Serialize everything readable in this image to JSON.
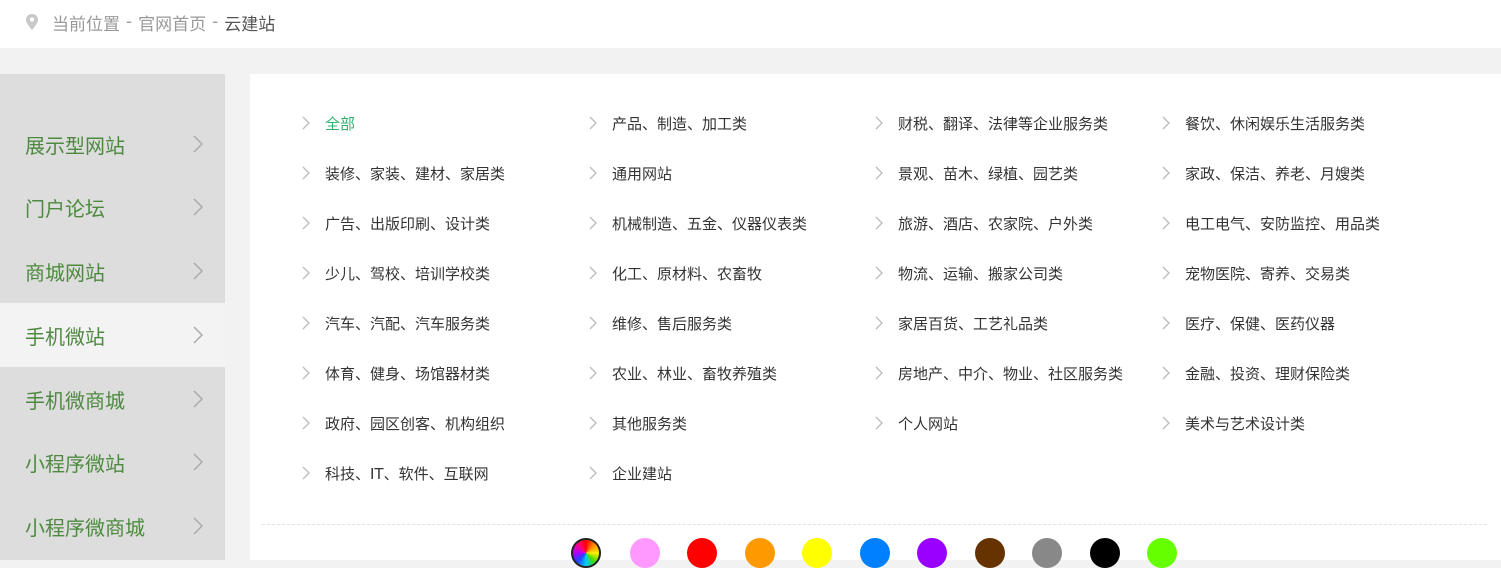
{
  "breadcrumb": {
    "label": "当前位置",
    "sep1": "-",
    "home": "官网首页",
    "sep2": "-",
    "current": "云建站"
  },
  "sidebar": {
    "items": [
      {
        "label": "展示型网站"
      },
      {
        "label": "门户论坛"
      },
      {
        "label": "商城网站"
      },
      {
        "label": "手机微站",
        "active": true
      },
      {
        "label": "手机微商城"
      },
      {
        "label": "小程序微站"
      },
      {
        "label": "小程序微商城"
      }
    ]
  },
  "categories": {
    "items": [
      {
        "label": "全部",
        "active": true
      },
      {
        "label": "产品、制造、加工类"
      },
      {
        "label": "财税、翻译、法律等企业服务类"
      },
      {
        "label": "餐饮、休闲娱乐生活服务类"
      },
      {
        "label": "装修、家装、建材、家居类"
      },
      {
        "label": "通用网站"
      },
      {
        "label": "景观、苗木、绿植、园艺类"
      },
      {
        "label": "家政、保洁、养老、月嫂类"
      },
      {
        "label": "广告、出版印刷、设计类"
      },
      {
        "label": "机械制造、五金、仪器仪表类"
      },
      {
        "label": "旅游、酒店、农家院、户外类"
      },
      {
        "label": "电工电气、安防监控、用品类"
      },
      {
        "label": "少儿、驾校、培训学校类"
      },
      {
        "label": "化工、原材料、农畜牧"
      },
      {
        "label": "物流、运输、搬家公司类"
      },
      {
        "label": "宠物医院、寄养、交易类"
      },
      {
        "label": "汽车、汽配、汽车服务类"
      },
      {
        "label": "维修、售后服务类"
      },
      {
        "label": "家居百货、工艺礼品类"
      },
      {
        "label": "医疗、保健、医药仪器"
      },
      {
        "label": "体育、健身、场馆器材类"
      },
      {
        "label": "农业、林业、畜牧养殖类"
      },
      {
        "label": "房地产、中介、物业、社区服务类"
      },
      {
        "label": "金融、投资、理财保险类"
      },
      {
        "label": "政府、园区创客、机构组织"
      },
      {
        "label": "其他服务类"
      },
      {
        "label": "个人网站"
      },
      {
        "label": "美术与艺术设计类"
      },
      {
        "label": "科技、IT、软件、互联网"
      },
      {
        "label": "企业建站"
      }
    ]
  },
  "colors": {
    "accent_green": "#33b06e",
    "sidebar_text": "#4d8a3f",
    "swatches": [
      "#ff99ff",
      "#ff0000",
      "#ff9900",
      "#ffff00",
      "#0080ff",
      "#9900ff",
      "#663300",
      "#888888",
      "#000000",
      "#66ff00"
    ]
  }
}
